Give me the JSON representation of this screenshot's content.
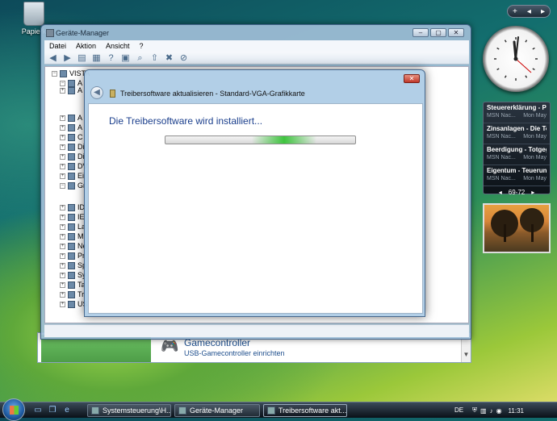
{
  "desktop": {
    "recycle_bin_label": "Papierk"
  },
  "device_manager": {
    "title": "Geräte-Manager",
    "menu": [
      "Datei",
      "Aktion",
      "Ansicht",
      "?"
    ],
    "computer_name": "VISTA",
    "tree_items": [
      "A",
      "A",
      "A",
      "A",
      "C",
      "Di",
      "Di",
      "DV",
      "Ei",
      "Gr",
      "ID",
      "IE",
      "La",
      "M",
      "Ne",
      "Pr",
      "Sp",
      "Sy",
      "Ta",
      "Tr",
      "US"
    ]
  },
  "control_panel_bg": {
    "title": "Gamecontroller",
    "subtitle": "USB-Gamecontroller einrichten"
  },
  "dialog": {
    "title": "Treibersoftware aktualisieren - Standard-VGA-Grafikkarte",
    "heading": "Die Treibersoftware wird installiert...",
    "progress": 0.62
  },
  "sidebar": {
    "feed": [
      {
        "headline": "Steuererklärung - PC ...",
        "source": "MSN Nac...",
        "date": "Mon May"
      },
      {
        "headline": "Zinsanlagen - Die To...",
        "source": "MSN Nac...",
        "date": "Mon May"
      },
      {
        "headline": "Beerdigung - Totgegl...",
        "source": "MSN Nac...",
        "date": "Mon May"
      },
      {
        "headline": "Eigentum - Teuerung...",
        "source": "MSN Nac...",
        "date": "Mon May"
      }
    ],
    "feed_pages": "69-72",
    "controls": [
      "+",
      "◂",
      "▸"
    ]
  },
  "taskbar": {
    "buttons": [
      "Systemsteuerung\\H...",
      "Geräte-Manager",
      "Treibersoftware akt..."
    ],
    "language": "DE",
    "time": "11:31"
  }
}
